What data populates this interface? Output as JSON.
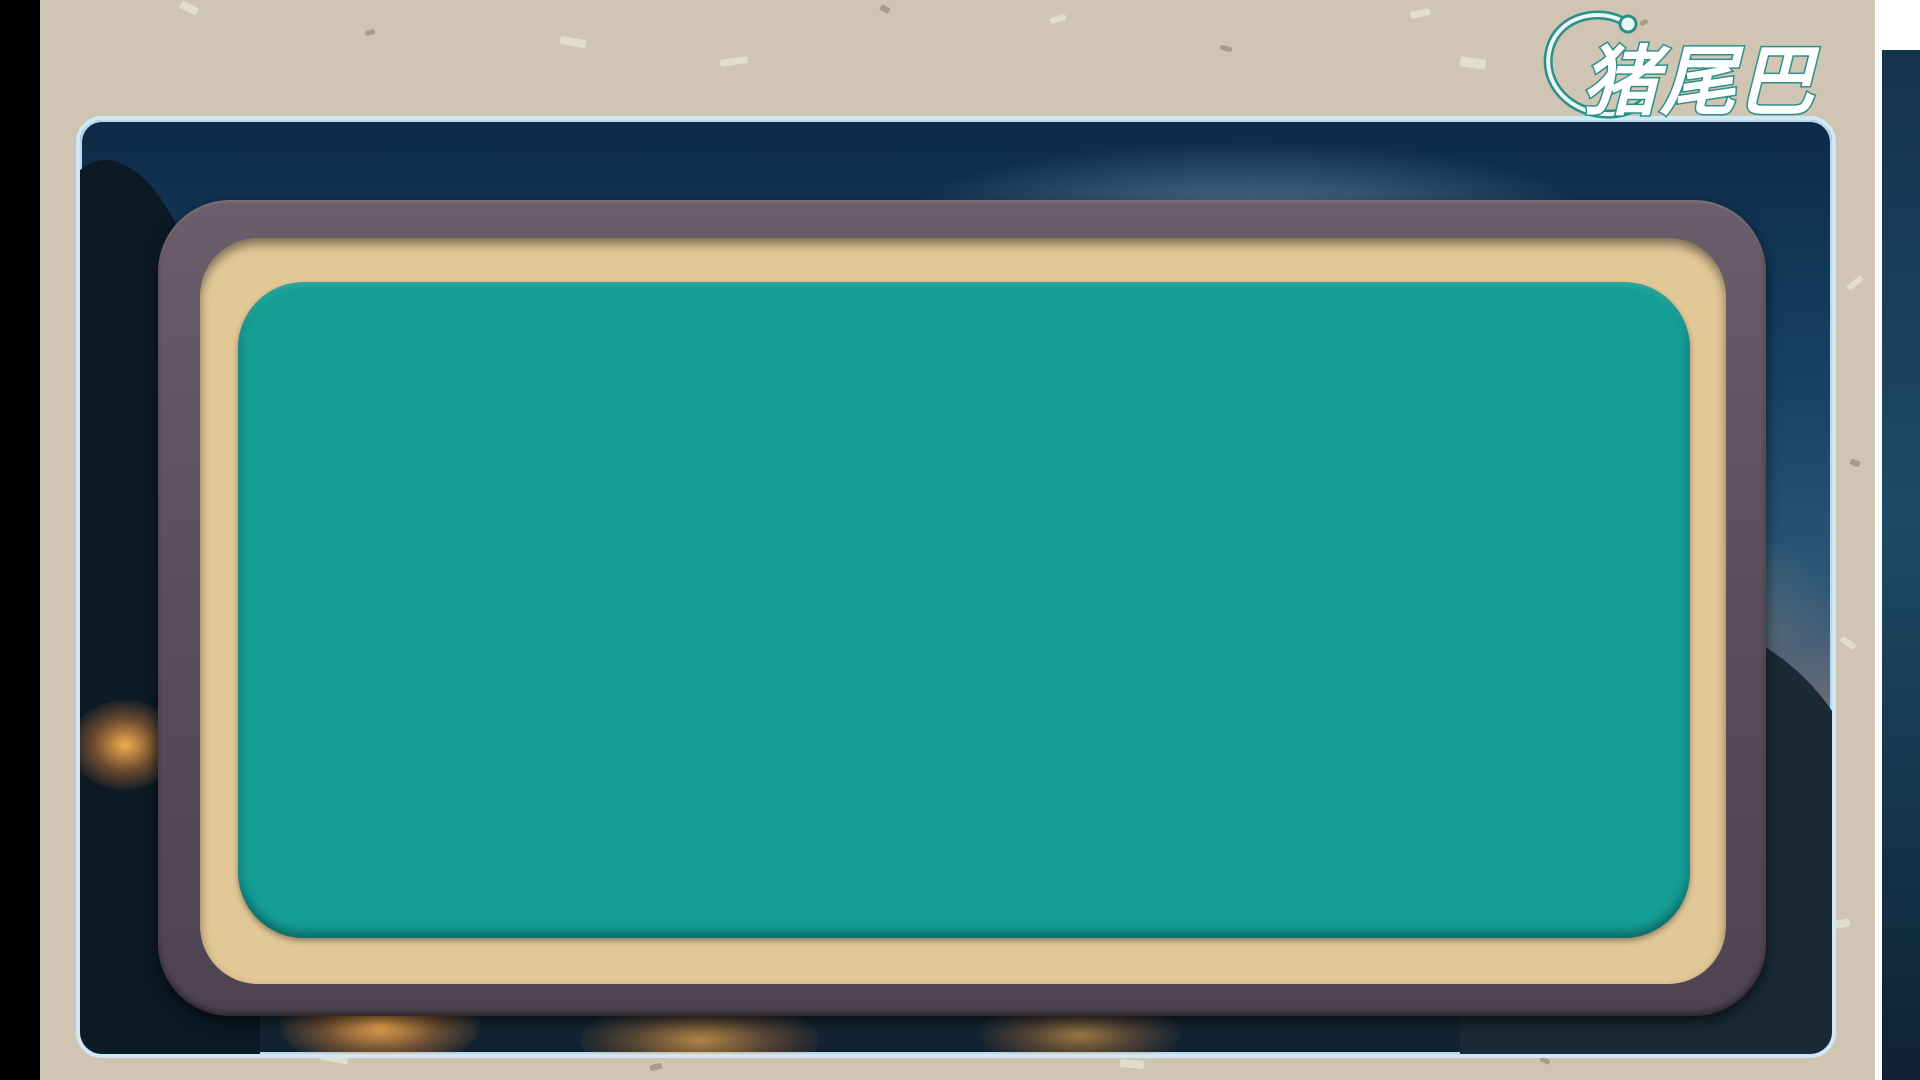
{
  "brand": {
    "logo_text": "猪尾巴",
    "logo_icon": "pig-tail-swirl-icon",
    "accent": "#2b8f8a"
  },
  "display": {
    "panel_color": "#139e96",
    "mat_color": "#e2c797",
    "frame_color": "#5a4e5b"
  },
  "background": {
    "scene": "night-town-sky"
  }
}
